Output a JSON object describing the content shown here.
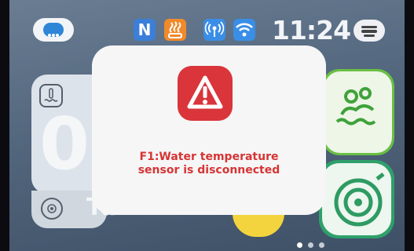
{
  "status_bar": {
    "chat_icon": "chat-bubble-icon",
    "n_badge": "N",
    "heater_icon": "heater-icon",
    "signal_icon": "signal-tower-icon",
    "wifi_icon": "wifi-icon",
    "time": "11:24",
    "menu_icon": "menu-icon"
  },
  "background": {
    "temperature_icon": "water-temperature-icon",
    "temperature_value": "0",
    "mode_icon": "sun-mode-icon",
    "mode_label_partial": "Tu",
    "right_top_icon": "bathing-people-icon",
    "right_bottom_icon": "hose-reel-icon"
  },
  "pager": {
    "count": 3,
    "active": 0
  },
  "modal": {
    "icon": "warning-icon",
    "message_line1": "F1:Water temperature",
    "message_line2": "sensor is disconnected"
  },
  "colors": {
    "alert_red": "#d9353a",
    "alert_text": "#d63535",
    "accent_blue": "#3a8ee6",
    "accent_orange": "#f08a2a",
    "green": "#69bf43",
    "teal": "#2fa06b",
    "yellow": "#f3d43e"
  }
}
